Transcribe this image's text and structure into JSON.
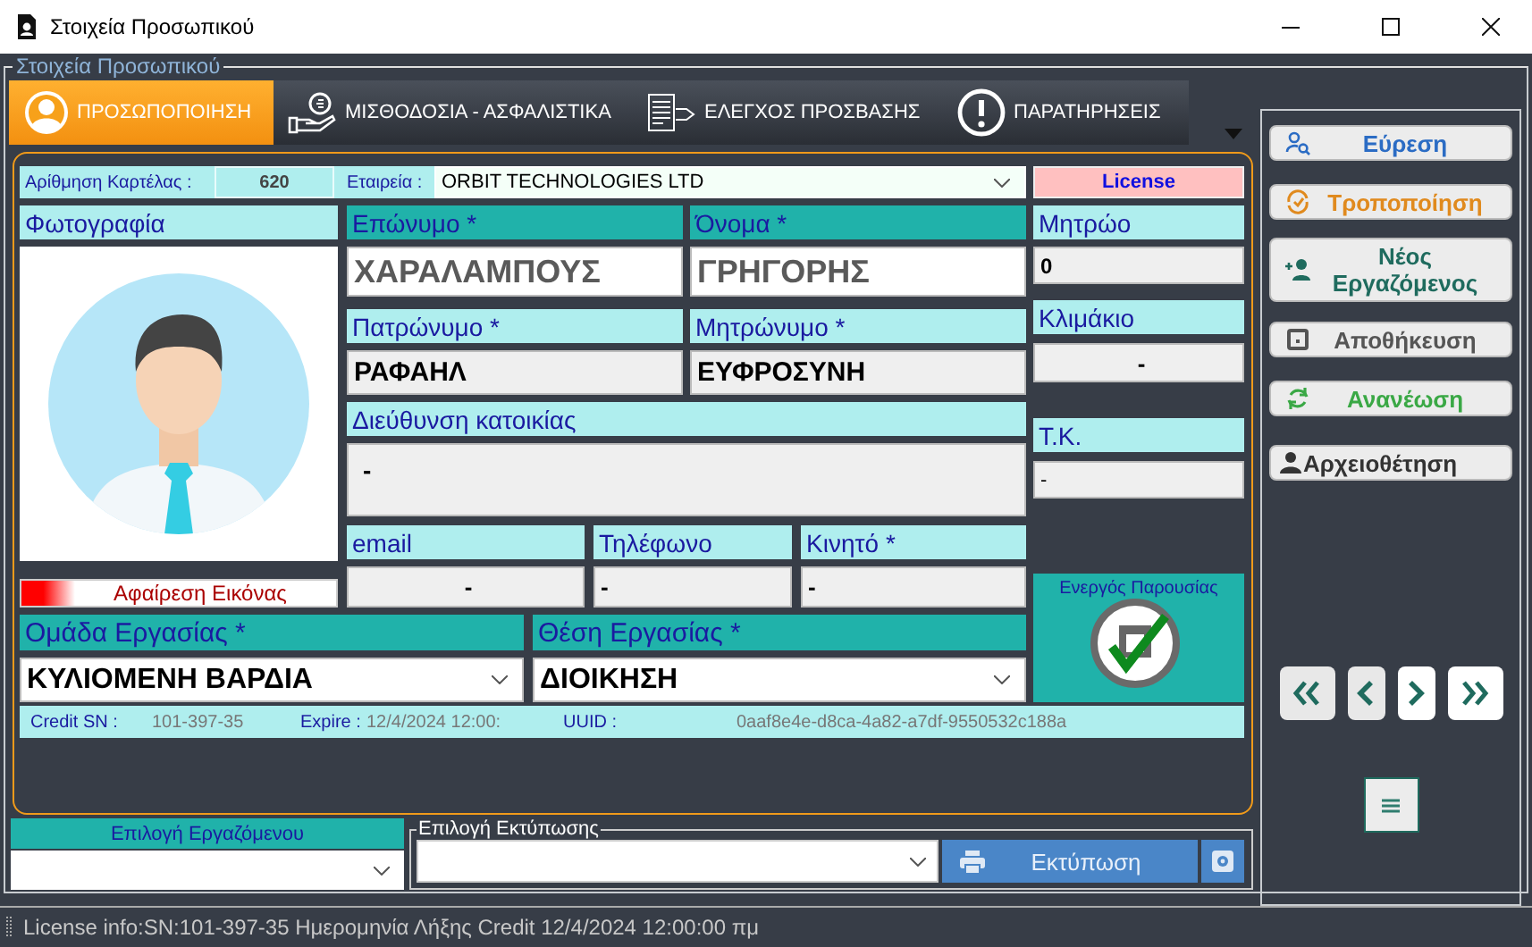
{
  "window": {
    "title": "Στοιχεία Προσωπικού"
  },
  "group_title": "Στοιχεία Προσωπικού",
  "tabs": [
    {
      "label": "ΠΡΟΣΩΠΟΠΟΙΗΣΗ",
      "selected": true
    },
    {
      "label": "ΜΙΣΘΟΔΟΣΙΑ - ΑΣΦΑΛΙΣΤΙΚΑ",
      "selected": false
    },
    {
      "label": "ΕΛΕΓΧΟΣ ΠΡΟΣΒΑΣΗΣ",
      "selected": false
    },
    {
      "label": "ΠΑΡΑΤΗΡΗΣΕΙΣ",
      "selected": false
    }
  ],
  "card_number": {
    "label": "Αρίθμηση Καρτέλας :",
    "value": "620"
  },
  "company": {
    "label": "Εταιρεία :",
    "value": "ORBIT TECHNOLOGIES LTD"
  },
  "license": "License",
  "photo": {
    "label": "Φωτογραφία",
    "remove_button": "Αφαίρεση Εικόνας"
  },
  "surname": {
    "label": "Επώνυμο *",
    "value": "ΧΑΡΑΛΑΜΠΟΥΣ",
    "highlighted": true
  },
  "first_name": {
    "label": "Όνομα *",
    "value": "ΓΡΗΓΟΡΗΣ",
    "highlighted": true
  },
  "father_name": {
    "label": "Πατρώνυμο *",
    "value": "ΡΑΦΑΗΛ",
    "highlighted": false
  },
  "mother_name": {
    "label": "Μητρώνυμο *",
    "value": "ΕΥΦΡΟΣΥΝΗ",
    "highlighted": false
  },
  "address": {
    "label": "Διεύθυνση κατοικίας",
    "value": "-",
    "highlighted": false
  },
  "email": {
    "label": "email",
    "value": "-",
    "highlighted": false
  },
  "phone": {
    "label": "Τηλέφωνο",
    "value": "-",
    "highlighted": false
  },
  "mobile": {
    "label": "Κινητό *",
    "value": "-",
    "highlighted": false
  },
  "registry": {
    "label": "Μητρώο",
    "value": "0",
    "highlighted": false
  },
  "level": {
    "label": "Κλιμάκιο",
    "value": "-",
    "highlighted": false
  },
  "postal_code": {
    "label": "Τ.Κ.",
    "value": "-",
    "highlighted": false
  },
  "work_group": {
    "label": "Ομάδα Εργασίας *",
    "value": "ΚΥΛΙΟΜΕΝΗ ΒΑΡΔΙΑ",
    "highlighted": true
  },
  "position": {
    "label": "Θέση Εργασίας *",
    "value": "ΔΙΟΙΚΗΣΗ",
    "highlighted": true
  },
  "presence": {
    "label": "Ενεργός Παρουσίας",
    "checked": true
  },
  "credit": [
    {
      "label": "Credit SN :",
      "value": "101-397-35"
    },
    {
      "label": "Expire :",
      "value": "12/4/2024 12:00:"
    },
    {
      "label": "UUID :",
      "value": "0aaf8e4e-d8ca-4a82-a7df-9550532c188a"
    }
  ],
  "actions": [
    {
      "label": "Εύρεση",
      "color": "#2b6cc4"
    },
    {
      "label": "Τροποποίηση",
      "color": "#e08a1e"
    },
    {
      "label": "Νέος Εργαζόμενος",
      "color": "#1f6b5e"
    },
    {
      "label": "Αποθήκευση",
      "color": "#555555"
    },
    {
      "label": "Ανανέωση",
      "color": "#3aa845"
    },
    {
      "label": "Αρχειοθέτηση",
      "color": "#333333"
    }
  ],
  "employee_select": {
    "label": "Επιλογή Εργαζόμενου"
  },
  "print": {
    "title": "Επιλογή Εκτύπωσης",
    "button": "Εκτύπωση"
  },
  "status_bar": "License info:SN:101-397-35 Ημερομηνία Λήξης Credit 12/4/2024 12:00:00 πμ"
}
